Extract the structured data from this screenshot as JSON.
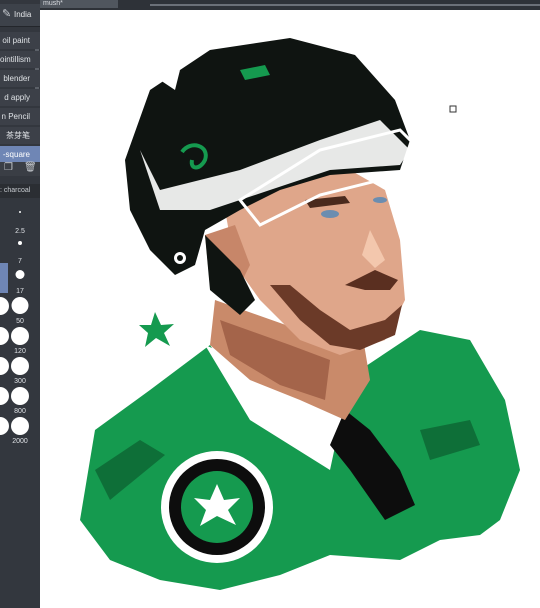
{
  "document": {
    "tab_title": "mush*"
  },
  "brush_panel": {
    "group_name": "India",
    "brushes": [
      {
        "label": "oil paint"
      },
      {
        "label": "ointillism"
      },
      {
        "label": "blender"
      },
      {
        "label": "d apply"
      },
      {
        "label": "n Pencil"
      },
      {
        "label": "茶芽笔"
      },
      {
        "label": "-square"
      }
    ],
    "selected_index": 6,
    "sub_tool_label": ": charcoal",
    "sizes": [
      {
        "label": "2.5"
      },
      {
        "label": "7"
      },
      {
        "label": "17"
      },
      {
        "label": "50"
      },
      {
        "label": "120"
      },
      {
        "label": "300"
      },
      {
        "label": "800"
      },
      {
        "label": "2000"
      }
    ]
  },
  "colors": {
    "panel_bg": "#33373e",
    "selection": "#6f86b5",
    "jersey_green": "#159a4f",
    "helmet_black": "#0f1411"
  }
}
